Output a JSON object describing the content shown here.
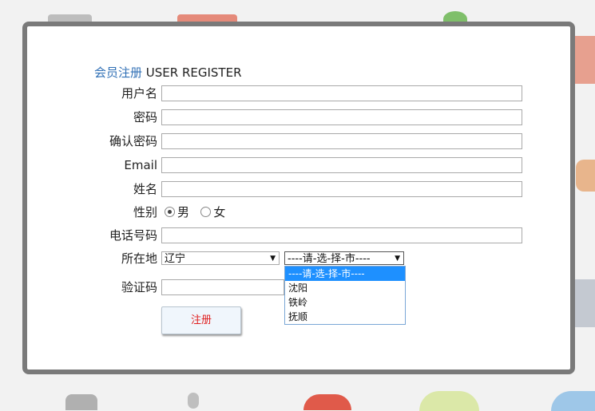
{
  "form": {
    "title_cn": "会员注册",
    "title_en": "USER REGISTER",
    "username_label": "用户名",
    "password_label": "密码",
    "confirm_label": "确认密码",
    "email_label": "Email",
    "name_label": "姓名",
    "gender_label": "性别",
    "gender_male": "男",
    "gender_female": "女",
    "gender_selected": "男",
    "phone_label": "电话号码",
    "location_label": "所在地",
    "province_value": "辽宁",
    "city_value": "----请-选-择-市----",
    "city_options": [
      "----请-选-择-市----",
      "沈阳",
      "铁岭",
      "抚顺"
    ],
    "captcha_label": "验证码",
    "submit_label": "注册"
  }
}
